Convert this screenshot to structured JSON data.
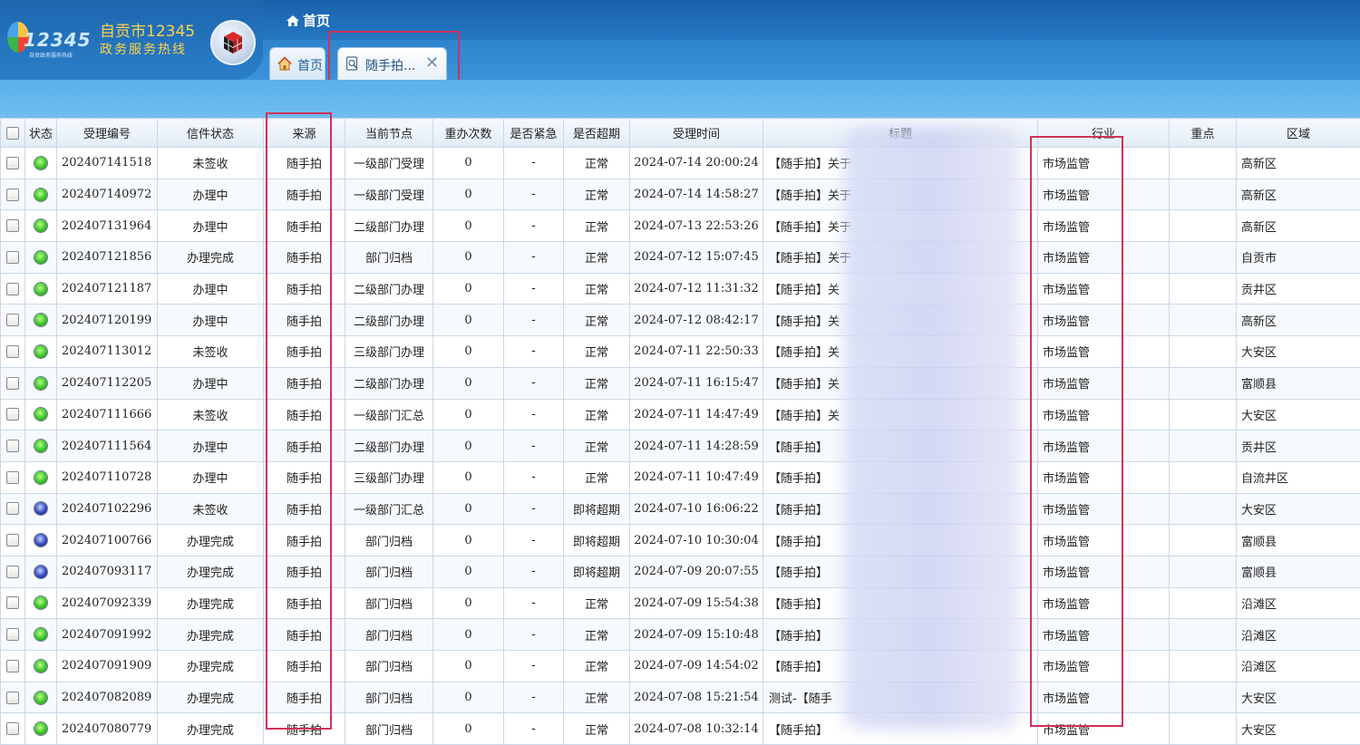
{
  "app": {
    "logo_number": "12345",
    "logo_subtitle": "自贡政务服务热线",
    "org_name": "自贡市12345",
    "org_subtitle": "政务服务热线",
    "breadcrumb": "首页"
  },
  "tabs": [
    {
      "label": "首页",
      "active": false
    },
    {
      "label": "随手拍...",
      "active": true,
      "close": "✕"
    }
  ],
  "columns": {
    "status": "状态",
    "id": "受理编号",
    "letter_status": "信件状态",
    "source": "来源",
    "node": "当前节点",
    "redo": "重办次数",
    "urgent": "是否紧急",
    "overdue": "是否超期",
    "time": "受理时间",
    "title": "标题",
    "industry": "行业",
    "key": "重点",
    "area": "区域"
  },
  "rows": [
    {
      "dot": "green",
      "id": "202407141518",
      "letter_status": "未签收",
      "source": "随手拍",
      "node": "一级部门受理",
      "redo": "0",
      "urgent": "-",
      "overdue": "正常",
      "time": "2024-07-14 20:00:24",
      "title": "【随手拍】关于",
      "title_color": "red",
      "industry": "市场监管",
      "key": "",
      "area": "高新区"
    },
    {
      "dot": "green",
      "id": "202407140972",
      "letter_status": "办理中",
      "source": "随手拍",
      "node": "一级部门受理",
      "redo": "0",
      "urgent": "-",
      "overdue": "正常",
      "time": "2024-07-14 14:58:27",
      "title": "【随手拍】关于",
      "title_color": "blue",
      "industry": "市场监管",
      "key": "",
      "area": "高新区"
    },
    {
      "dot": "green",
      "id": "202407131964",
      "letter_status": "办理中",
      "source": "随手拍",
      "node": "二级部门办理",
      "redo": "0",
      "urgent": "-",
      "overdue": "正常",
      "time": "2024-07-13 22:53:26",
      "title": "【随手拍】关于",
      "title_color": "blue",
      "industry": "市场监管",
      "key": "",
      "area": "高新区"
    },
    {
      "dot": "green",
      "id": "202407121856",
      "letter_status": "办理完成",
      "source": "随手拍",
      "node": "部门归档",
      "redo": "0",
      "urgent": "-",
      "overdue": "正常",
      "time": "2024-07-12 15:07:45",
      "title": "【随手拍】关于",
      "title_color": "blue",
      "industry": "市场监管",
      "key": "",
      "area": "自贡市"
    },
    {
      "dot": "green",
      "id": "202407121187",
      "letter_status": "办理中",
      "source": "随手拍",
      "node": "二级部门办理",
      "redo": "0",
      "urgent": "-",
      "overdue": "正常",
      "time": "2024-07-12 11:31:32",
      "title": "【随手拍】关",
      "title_color": "blue",
      "industry": "市场监管",
      "key": "",
      "area": "贡井区"
    },
    {
      "dot": "green",
      "id": "202407120199",
      "letter_status": "办理中",
      "source": "随手拍",
      "node": "二级部门办理",
      "redo": "0",
      "urgent": "-",
      "overdue": "正常",
      "time": "2024-07-12 08:42:17",
      "title": "【随手拍】关",
      "title_color": "blue",
      "industry": "市场监管",
      "key": "",
      "area": "高新区"
    },
    {
      "dot": "green",
      "id": "202407113012",
      "letter_status": "未签收",
      "source": "随手拍",
      "node": "三级部门办理",
      "redo": "0",
      "urgent": "-",
      "overdue": "正常",
      "time": "2024-07-11 22:50:33",
      "title": "【随手拍】关",
      "title_color": "red",
      "industry": "市场监管",
      "key": "",
      "area": "大安区"
    },
    {
      "dot": "green",
      "id": "202407112205",
      "letter_status": "办理中",
      "source": "随手拍",
      "node": "二级部门办理",
      "redo": "0",
      "urgent": "-",
      "overdue": "正常",
      "time": "2024-07-11 16:15:47",
      "title": "【随手拍】关",
      "title_color": "blue",
      "industry": "市场监管",
      "key": "",
      "area": "富顺县"
    },
    {
      "dot": "green",
      "id": "202407111666",
      "letter_status": "未签收",
      "source": "随手拍",
      "node": "一级部门汇总",
      "redo": "0",
      "urgent": "-",
      "overdue": "正常",
      "time": "2024-07-11 14:47:49",
      "title": "【随手拍】关",
      "title_color": "red",
      "industry": "市场监管",
      "key": "",
      "area": "大安区"
    },
    {
      "dot": "green",
      "id": "202407111564",
      "letter_status": "办理中",
      "source": "随手拍",
      "node": "二级部门办理",
      "redo": "0",
      "urgent": "-",
      "overdue": "正常",
      "time": "2024-07-11 14:28:59",
      "title": "【随手拍】",
      "title_color": "blue",
      "industry": "市场监管",
      "key": "",
      "area": "贡井区"
    },
    {
      "dot": "green",
      "id": "202407110728",
      "letter_status": "办理中",
      "source": "随手拍",
      "node": "三级部门办理",
      "redo": "0",
      "urgent": "-",
      "overdue": "正常",
      "time": "2024-07-11 10:47:49",
      "title": "【随手拍】",
      "title_color": "blue",
      "industry": "市场监管",
      "key": "",
      "area": "自流井区"
    },
    {
      "dot": "blue",
      "id": "202407102296",
      "letter_status": "未签收",
      "source": "随手拍",
      "node": "一级部门汇总",
      "redo": "0",
      "urgent": "-",
      "overdue": "即将超期",
      "time": "2024-07-10 16:06:22",
      "title": "【随手拍】",
      "title_color": "red",
      "industry": "市场监管",
      "key": "",
      "area": "大安区"
    },
    {
      "dot": "blue",
      "id": "202407100766",
      "letter_status": "办理完成",
      "source": "随手拍",
      "node": "部门归档",
      "redo": "0",
      "urgent": "-",
      "overdue": "即将超期",
      "time": "2024-07-10 10:30:04",
      "title": "【随手拍】",
      "title_color": "blue",
      "industry": "市场监管",
      "key": "",
      "area": "富顺县"
    },
    {
      "dot": "blue",
      "id": "202407093117",
      "letter_status": "办理完成",
      "source": "随手拍",
      "node": "部门归档",
      "redo": "0",
      "urgent": "-",
      "overdue": "即将超期",
      "time": "2024-07-09 20:07:55",
      "title": "【随手拍】",
      "title_color": "blue",
      "industry": "市场监管",
      "key": "",
      "area": "富顺县"
    },
    {
      "dot": "green",
      "id": "202407092339",
      "letter_status": "办理完成",
      "source": "随手拍",
      "node": "部门归档",
      "redo": "0",
      "urgent": "-",
      "overdue": "正常",
      "time": "2024-07-09 15:54:38",
      "title": "【随手拍】",
      "title_color": "blue",
      "industry": "市场监管",
      "key": "",
      "area": "沿滩区"
    },
    {
      "dot": "green",
      "id": "202407091992",
      "letter_status": "办理完成",
      "source": "随手拍",
      "node": "部门归档",
      "redo": "0",
      "urgent": "-",
      "overdue": "正常",
      "time": "2024-07-09 15:10:48",
      "title": "【随手拍】",
      "title_color": "blue",
      "industry": "市场监管",
      "key": "",
      "area": "沿滩区"
    },
    {
      "dot": "green",
      "id": "202407091909",
      "letter_status": "办理完成",
      "source": "随手拍",
      "node": "部门归档",
      "redo": "0",
      "urgent": "-",
      "overdue": "正常",
      "time": "2024-07-09 14:54:02",
      "title": "【随手拍】",
      "title_color": "blue",
      "industry": "市场监管",
      "key": "",
      "area": "沿滩区"
    },
    {
      "dot": "green",
      "id": "202407082089",
      "letter_status": "办理完成",
      "source": "随手拍",
      "node": "部门归档",
      "redo": "0",
      "urgent": "-",
      "overdue": "正常",
      "time": "2024-07-08 15:21:54",
      "title": "测试-【随手",
      "title_color": "blue",
      "industry": "市场监管",
      "key": "",
      "area": "大安区"
    },
    {
      "dot": "green",
      "id": "202407080779",
      "letter_status": "办理完成",
      "source": "随手拍",
      "node": "部门归档",
      "redo": "0",
      "urgent": "-",
      "overdue": "正常",
      "time": "2024-07-08 10:32:14",
      "title": "【随手拍】",
      "title_color": "blue",
      "industry": "市场监管",
      "key": "",
      "area": "大安区"
    }
  ],
  "colors": {
    "header_blue": "#2477c2",
    "accent_yellow": "#ffd24a",
    "highlight_red": "#d1315a",
    "title_red": "#e4202f",
    "title_blue": "#1e4fc9"
  }
}
